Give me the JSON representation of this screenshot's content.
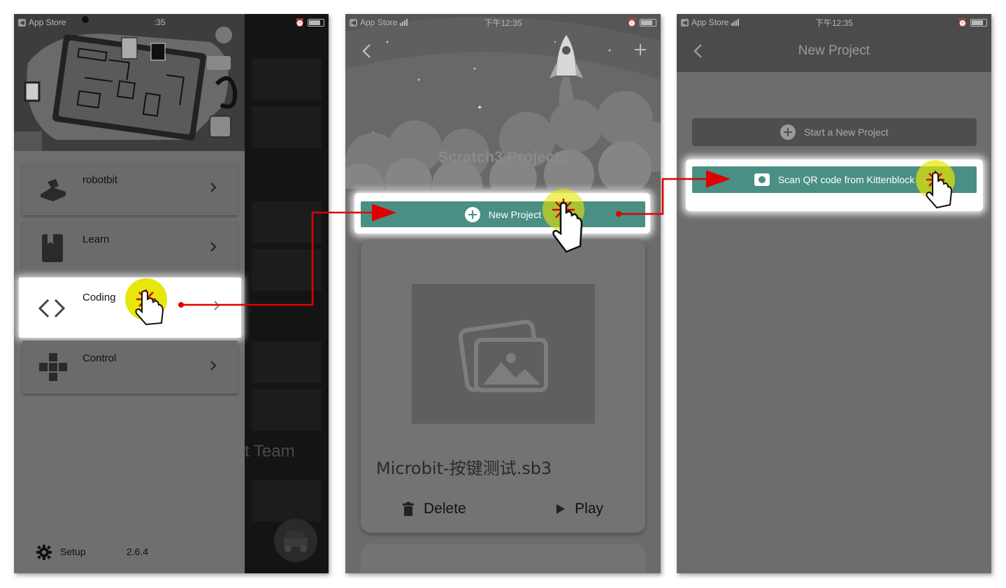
{
  "phone1": {
    "status": {
      "carrier": "App Store",
      "time": ":35"
    },
    "menu": [
      {
        "label": "robotbit",
        "icon": "robot-icon"
      },
      {
        "label": "Learn",
        "icon": "book-icon"
      },
      {
        "label": "Coding",
        "icon": "code-icon"
      },
      {
        "label": "Control",
        "icon": "gamepad-icon"
      }
    ],
    "team_text": "t Team",
    "setup_label": "Setup",
    "version": "2.6.4"
  },
  "phone2": {
    "status": {
      "carrier": "App Store",
      "time": "下午12:35"
    },
    "hero_title": "Scratch3 Projects",
    "new_project_label": "New Project",
    "card": {
      "name": "Microbit-按键测试.sb3",
      "delete_label": "Delete",
      "play_label": "Play"
    }
  },
  "phone3": {
    "status": {
      "carrier": "App Store",
      "time": "下午12:35"
    },
    "title": "New Project",
    "start_label": "Start a New Project",
    "scan_label": "Scan QR code from Kittenblock"
  },
  "colors": {
    "teal": "#4a8f84",
    "arrow": "#e00000",
    "pointer_highlight": "#e6e600"
  }
}
